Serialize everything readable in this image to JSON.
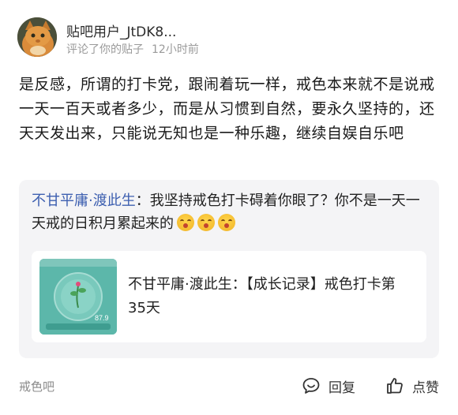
{
  "post": {
    "username": "贴吧用户_JtDK8...",
    "action": "评论了你的贴子",
    "time": "12小时前",
    "content": "是反感，所谓的打卡党，跟闹着玩一样，戒色本来就不是说戒一天一百天或者多少，而是从习惯到自然，要永久坚持的，还天天发出来，只能说无知也是一种乐趣，继续自娱自乐吧"
  },
  "quote": {
    "author": "不甘平庸·渡此生",
    "separator": "：",
    "text": "我坚持戒色打卡碍着你眼了？你不是一天一天戒的日积月累起来的",
    "emojis": [
      "laugh-cry-emoji",
      "laugh-cry-emoji",
      "laugh-cry-emoji"
    ]
  },
  "card": {
    "author": "不甘平庸·渡此生",
    "separator": "：",
    "title": "【成长记录】戒色打卡第35天",
    "thumb_value": "87.9"
  },
  "footer": {
    "forum": "戒色吧",
    "reply_label": "回复",
    "like_label": "点赞"
  },
  "colors": {
    "author_blue": "#3d5fb0",
    "quote_bg": "#f4f4f6",
    "meta_gray": "#9a9a9a"
  }
}
